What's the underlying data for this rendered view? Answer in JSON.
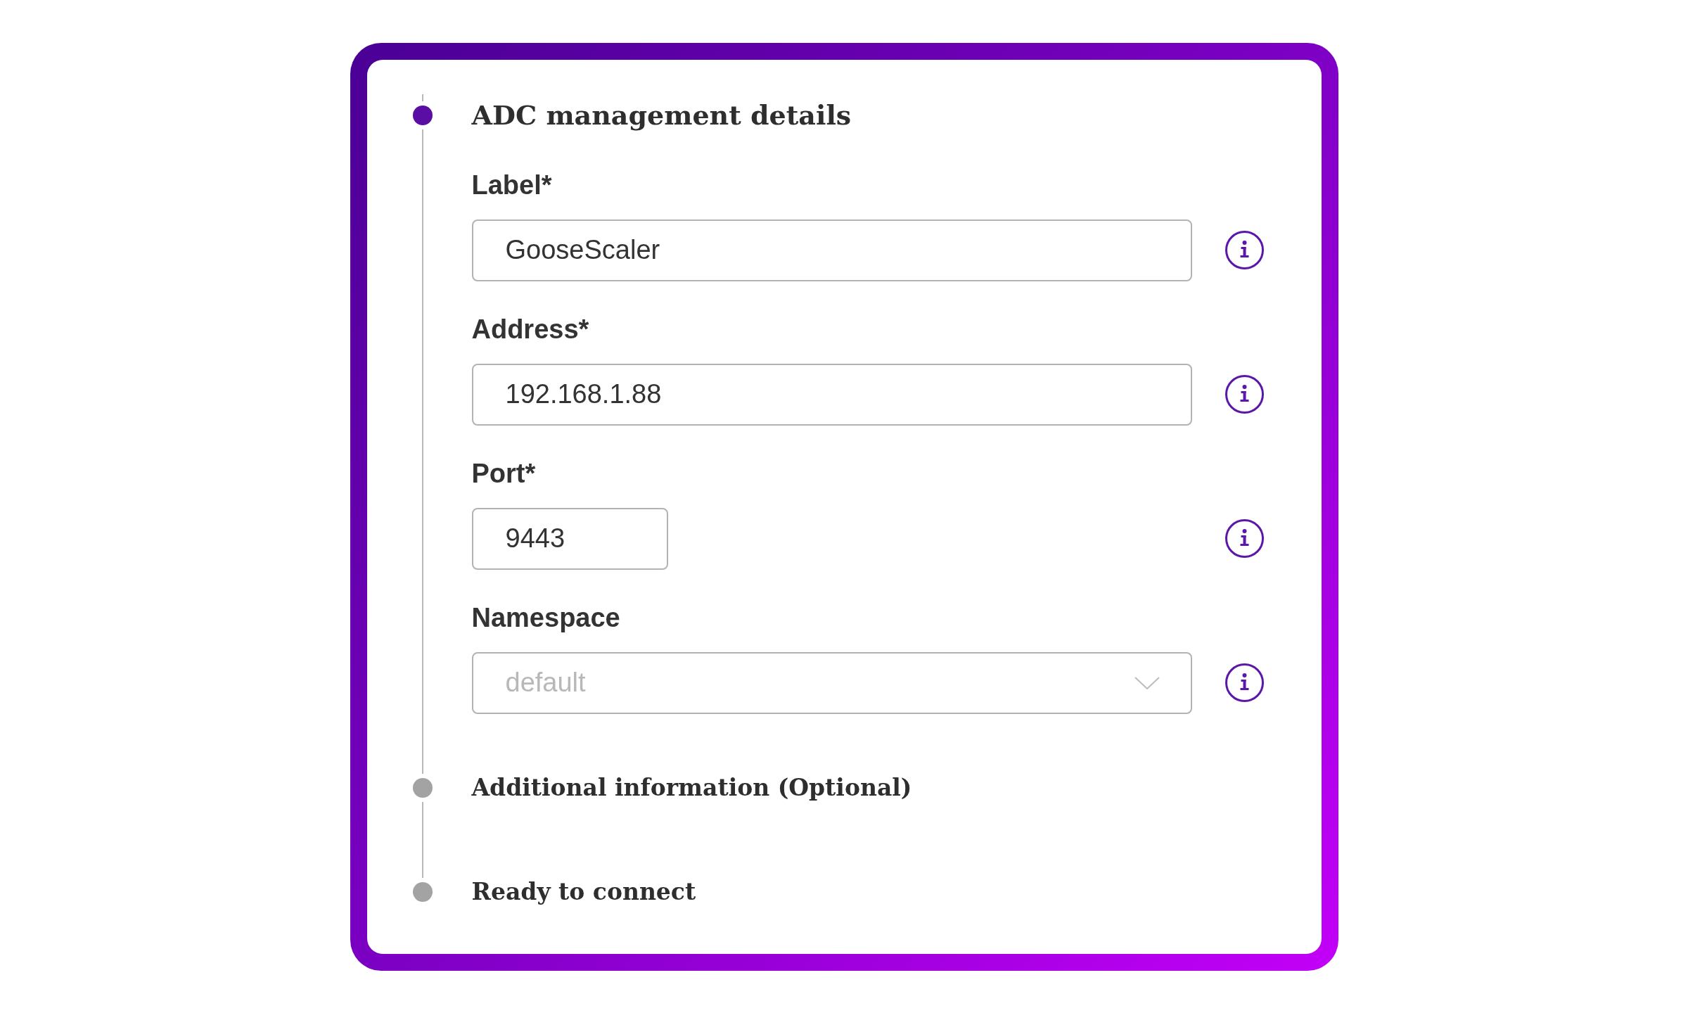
{
  "steps": [
    {
      "title": "ADC management details",
      "active": true,
      "fields": [
        {
          "kind": "text",
          "label": "Label*",
          "value": "GooseScaler"
        },
        {
          "kind": "text",
          "label": "Address*",
          "value": "192.168.1.88"
        },
        {
          "kind": "number",
          "label": "Port*",
          "value": "9443"
        },
        {
          "kind": "select",
          "label": "Namespace",
          "placeholder": "default"
        }
      ]
    },
    {
      "title": "Additional information (Optional)",
      "active": false
    },
    {
      "title": "Ready to connect",
      "active": false
    }
  ]
}
